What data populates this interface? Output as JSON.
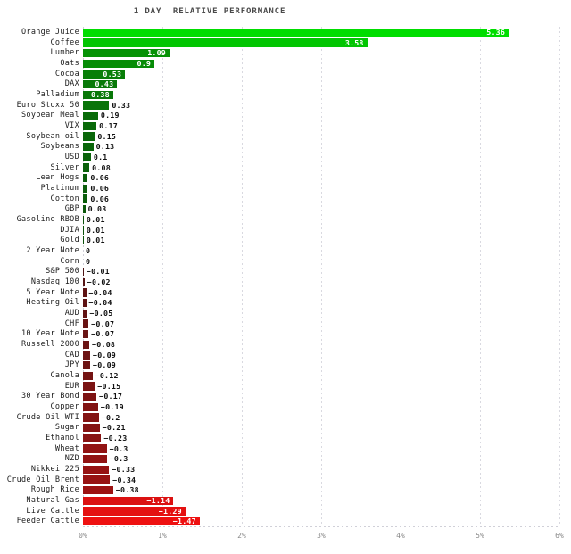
{
  "chart_data": {
    "type": "bar",
    "title": "1 DAY  RELATIVE PERFORMANCE",
    "xlabel": "",
    "ylabel": "",
    "orientation": "horizontal",
    "xlim": [
      0,
      6
    ],
    "xticks": [
      0,
      1,
      2,
      3,
      4,
      5,
      6
    ],
    "xticklabels": [
      "0%",
      "1%",
      "2%",
      "3%",
      "4%",
      "5%",
      "6%"
    ],
    "grid": true,
    "legend": false,
    "note": "Bar length encodes absolute value; sign encodes color (green positive, red negative).",
    "categories": [
      "Orange Juice",
      "Coffee",
      "Lumber",
      "Oats",
      "Cocoa",
      "DAX",
      "Palladium",
      "Euro Stoxx 50",
      "Soybean Meal",
      "VIX",
      "Soybean oil",
      "Soybeans",
      "USD",
      "Silver",
      "Lean Hogs",
      "Platinum",
      "Cotton",
      "GBP",
      "Gasoline RBOB",
      "DJIA",
      "Gold",
      "2 Year Note",
      "Corn",
      "S&P 500",
      "Nasdaq 100",
      "5 Year Note",
      "Heating Oil",
      "AUD",
      "CHF",
      "10 Year Note",
      "Russell 2000",
      "CAD",
      "JPY",
      "Canola",
      "EUR",
      "30 Year Bond",
      "Copper",
      "Crude Oil WTI",
      "Sugar",
      "Ethanol",
      "Wheat",
      "NZD",
      "Nikkei 225",
      "Crude Oil Brent",
      "Rough Rice",
      "Natural Gas",
      "Live Cattle",
      "Feeder Cattle"
    ],
    "values": [
      5.36,
      3.58,
      1.09,
      0.9,
      0.53,
      0.43,
      0.38,
      0.33,
      0.19,
      0.17,
      0.15,
      0.13,
      0.1,
      0.08,
      0.06,
      0.06,
      0.06,
      0.03,
      0.01,
      0.01,
      0.01,
      0,
      0,
      -0.01,
      -0.02,
      -0.04,
      -0.04,
      -0.05,
      -0.07,
      -0.07,
      -0.08,
      -0.09,
      -0.09,
      -0.12,
      -0.15,
      -0.17,
      -0.19,
      -0.2,
      -0.21,
      -0.23,
      -0.3,
      -0.3,
      -0.33,
      -0.34,
      -0.38,
      -1.14,
      -1.29,
      -1.47
    ],
    "value_labels": [
      "5.36",
      "3.58",
      "1.09",
      "0.9",
      "0.53",
      "0.43",
      "0.38",
      "0.33",
      "0.19",
      "0.17",
      "0.15",
      "0.13",
      "0.1",
      "0.08",
      "0.06",
      "0.06",
      "0.06",
      "0.03",
      "0.01",
      "0.01",
      "0.01",
      "0",
      "0",
      "−0.01",
      "−0.02",
      "−0.04",
      "−0.04",
      "−0.05",
      "−0.07",
      "−0.07",
      "−0.08",
      "−0.09",
      "−0.09",
      "−0.12",
      "−0.15",
      "−0.17",
      "−0.19",
      "−0.2",
      "−0.21",
      "−0.23",
      "−0.3",
      "−0.3",
      "−0.33",
      "−0.34",
      "−0.38",
      "−1.14",
      "−1.29",
      "−1.47"
    ]
  },
  "colors": {
    "positive_max": "#00dd00",
    "positive_min": "#0c4a0c",
    "negative_min": "#3a1414",
    "negative_max": "#ee1111",
    "gridline": "#d9d9e0",
    "title_text": "#4a4a4a",
    "label_text": "#1c1c1c",
    "tick_text": "#8a8a8a",
    "background": "#ffffff"
  }
}
